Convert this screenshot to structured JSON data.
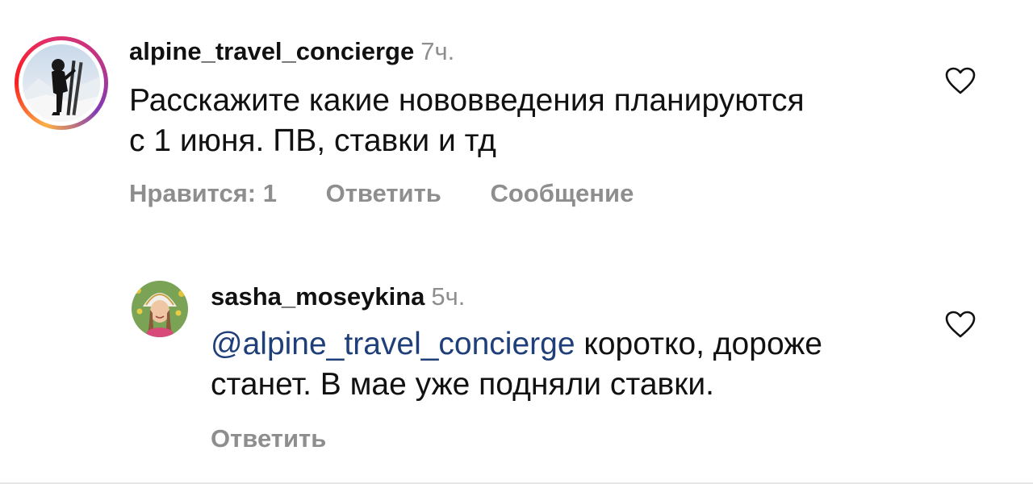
{
  "comments": [
    {
      "username": "alpine_travel_concierge",
      "time": "7ч.",
      "text_line1": "Расскажите какие нововведения планируются",
      "text_line2": "с 1 июня. ПВ, ставки и тд",
      "likes_label": "Нравится: 1",
      "reply_label": "Ответить",
      "message_label": "Сообщение",
      "avatar_icon": "skier-avatar",
      "has_story_ring": true
    }
  ],
  "replies": [
    {
      "username": "sasha_moseykina",
      "time": "5ч.",
      "mention": "@alpine_travel_concierge",
      "text_after_mention": " коротко, дороже",
      "text_line2": "станет. В мае уже подняли ставки.",
      "reply_label": "Ответить",
      "avatar_icon": "woman-kokoshnik-avatar"
    }
  ],
  "icons": {
    "like": "heart-outline-icon"
  },
  "colors": {
    "mention": "#1f3f7a",
    "secondary_text": "#8e8e8e",
    "story_ring_start": "#fcb045",
    "story_ring_end": "#833ab4"
  }
}
